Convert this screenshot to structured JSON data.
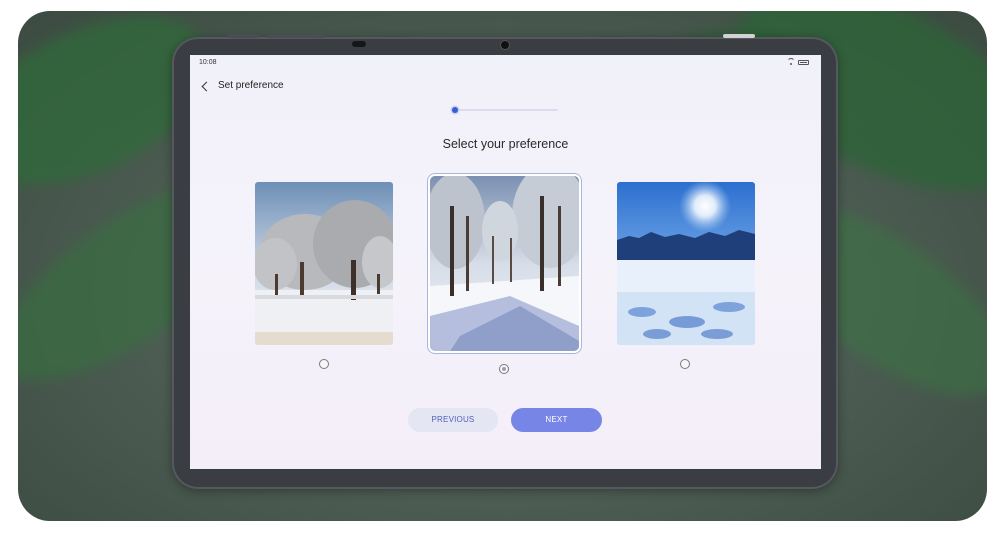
{
  "status_bar": {
    "time": "10:08",
    "icons": [
      "wifi-icon",
      "battery-icon"
    ]
  },
  "header": {
    "title": "Set preference",
    "back_icon": "chevron-left-icon"
  },
  "progress": {
    "current_step": 1
  },
  "main": {
    "heading": "Select your preference",
    "options": [
      {
        "id": "option-1",
        "selected": false
      },
      {
        "id": "option-2",
        "selected": true
      },
      {
        "id": "option-3",
        "selected": false
      }
    ]
  },
  "footer": {
    "previous_label": "PREVIOUS",
    "next_label": "NEXT"
  },
  "colors": {
    "accent": "#7786e6",
    "accent_dark": "#3a5bd6",
    "secondary_button": "#e4e6f3",
    "secondary_text": "#5360b8"
  }
}
